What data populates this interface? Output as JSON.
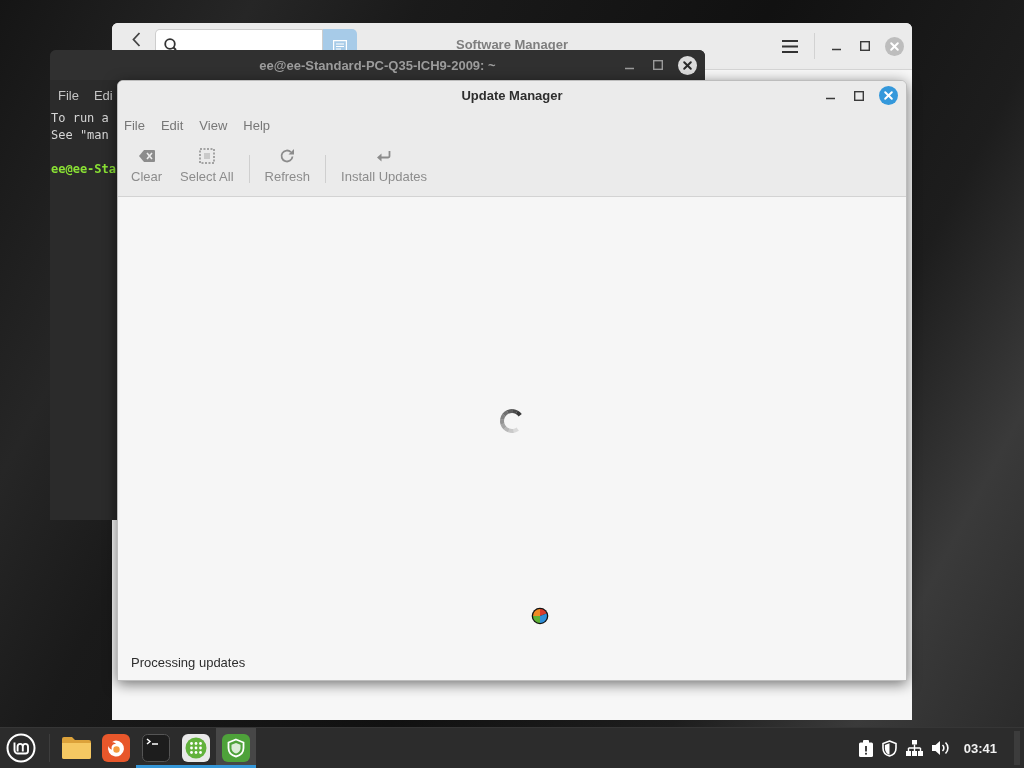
{
  "software_manager": {
    "title": "Software Manager",
    "active": false
  },
  "terminal": {
    "title": "ee@ee-Standard-PC-Q35-ICH9-2009: ~",
    "active": false,
    "menu": [
      "File",
      "Edi"
    ],
    "lines": [
      {
        "kind": "output",
        "text": "To run a"
      },
      {
        "kind": "output",
        "text": "See \"man"
      },
      {
        "kind": "prompt",
        "text": "ee@ee-Sta"
      }
    ]
  },
  "update_manager": {
    "title": "Update Manager",
    "active": true,
    "menu": [
      "File",
      "Edit",
      "View",
      "Help"
    ],
    "toolbar": [
      {
        "kind": "button",
        "label": "Clear",
        "disabled": true
      },
      {
        "kind": "button",
        "label": "Select All",
        "disabled": true
      },
      {
        "kind": "separator"
      },
      {
        "kind": "button",
        "label": "Refresh",
        "disabled": true
      },
      {
        "kind": "separator"
      },
      {
        "kind": "button",
        "label": "Install Updates",
        "disabled": true
      }
    ],
    "status": "Processing updates"
  },
  "taskbar": {
    "apps": [
      {
        "running": false,
        "selected": false
      },
      {
        "running": false,
        "selected": false
      },
      {
        "running": true,
        "selected": false
      },
      {
        "running": true,
        "selected": false
      },
      {
        "running": true,
        "selected": true
      }
    ],
    "clock": "03:41"
  }
}
